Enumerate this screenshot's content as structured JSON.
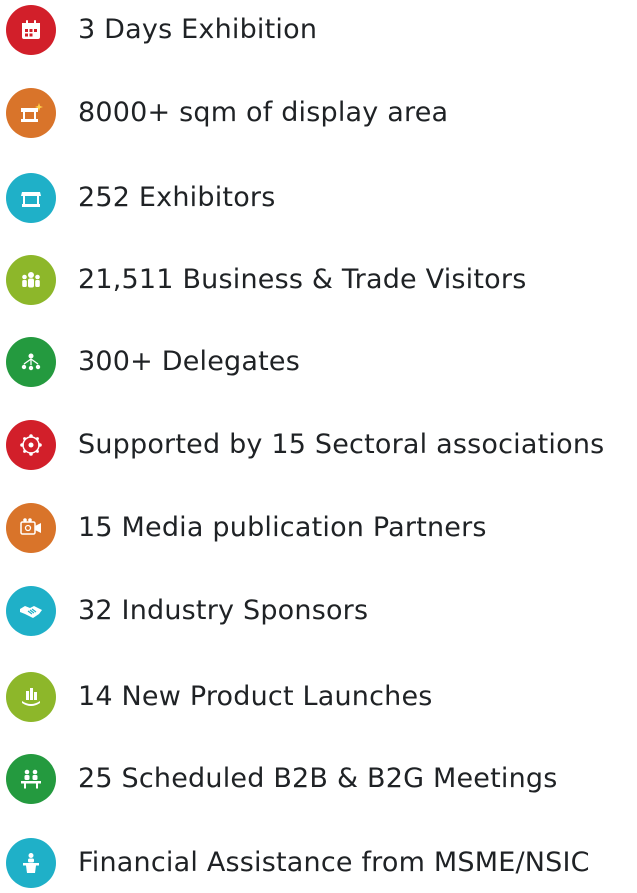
{
  "colors": {
    "red": "#d21f2a",
    "orange": "#d9742a",
    "cyan": "#1fb0c8",
    "lime": "#8db72a",
    "green": "#249a3f",
    "text": "#1f2225"
  },
  "items": [
    {
      "label": "3 Days Exhibition",
      "icon": "calendar-icon",
      "color": "red"
    },
    {
      "label": "8000+ sqm of display area",
      "icon": "stall-sparkle-icon",
      "color": "orange"
    },
    {
      "label": "252 Exhibitors",
      "icon": "shop-stall-icon",
      "color": "cyan"
    },
    {
      "label": "21,511 Business & Trade Visitors",
      "icon": "visitors-group-icon",
      "color": "lime"
    },
    {
      "label": "300+ Delegates",
      "icon": "network-people-icon",
      "color": "green"
    },
    {
      "label": "Supported by 15 Sectoral associations",
      "icon": "association-network-icon",
      "color": "red"
    },
    {
      "label": "15 Media publication Partners",
      "icon": "media-camera-icon",
      "color": "orange"
    },
    {
      "label": "32 Industry Sponsors",
      "icon": "handshake-icon",
      "color": "cyan"
    },
    {
      "label": "14 New Product Launches",
      "icon": "product-launch-icon",
      "color": "lime"
    },
    {
      "label": "25 Scheduled B2B & B2G Meetings",
      "icon": "meeting-table-icon",
      "color": "green"
    },
    {
      "label": "Financial Assistance from MSME/NSIC",
      "icon": "speaker-podium-icon",
      "color": "cyan"
    }
  ]
}
